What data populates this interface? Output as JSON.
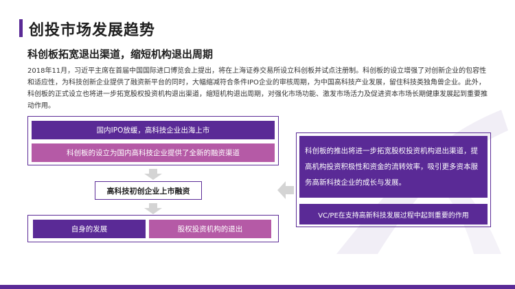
{
  "header": {
    "title": "创投市场发展趋势",
    "subtitle": "科创板拓宽退出渠道，缩短机构退出周期"
  },
  "intro_paragraph": "2018年11月，习近平主席在首届中国国际进口博览会上提出，将在上海证券交易所设立科创板并试点注册制。科创板的设立增强了对创新企业的包容性和适应性，为科技创新企业提供了融资新平台的同时，大幅缩减符合条件IPO企业的审核周期，为中国高科技产业发展，留住科技类独角兽企业。此外，科创板的正式设立也将进一步拓宽股权投资机构退出渠道，缩短机构退出周期，对强化市场功能、激发市场活力及促进资本市场长期健康发展起到重要推动作用。",
  "diagram": {
    "top_group": {
      "box1": "国内IPO放缓，高科技企业出海上市",
      "box2": "科创板的设立为国内高科技企业提供了全新的融资渠道"
    },
    "middle_box": "高科技初创企业上市融资",
    "bottom_group": {
      "left": "自身的发展",
      "right": "股权投资机构的退出"
    },
    "right_group": {
      "text": "科创板的推出将进一步拓宽股权投资机构退出渠道，提高机构投资积极性和资金的流转效率，吸引更多资本服务高新科技企业的成长与发展。",
      "footer": "VC/PE在支持高新科技发展过程中起到重要的作用"
    }
  },
  "colors": {
    "primary": "#5a2a96",
    "secondary": "#b55aa6",
    "arrow": "#d4d4d4"
  }
}
